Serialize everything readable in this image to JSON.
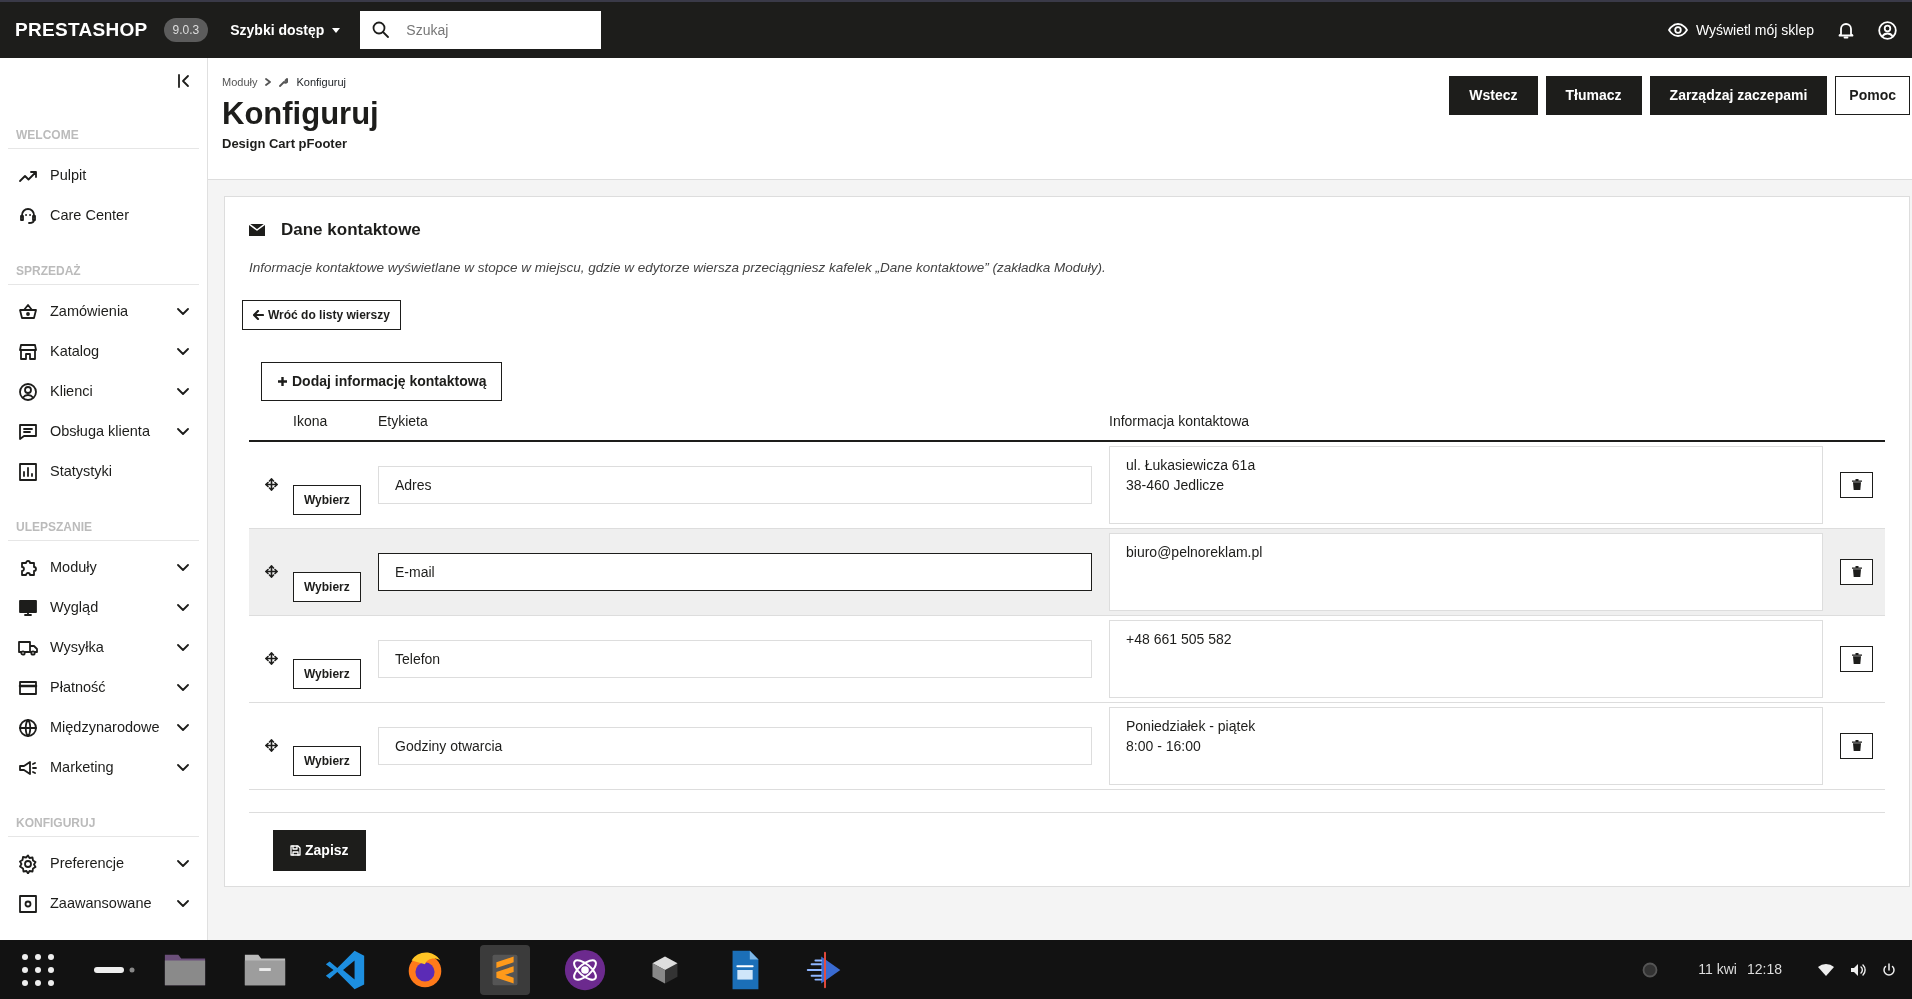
{
  "header": {
    "logo": "PRESTASHOP",
    "version": "9.0.3",
    "quick_access": "Szybki dostęp",
    "search": {
      "placeholder": "Szukaj"
    },
    "view_shop": "Wyświetl mój sklep"
  },
  "sidebar": {
    "sections": [
      {
        "title": "WELCOME",
        "items": [
          {
            "label": "Pulpit",
            "has_submenu": false
          },
          {
            "label": "Care Center",
            "has_submenu": false
          }
        ]
      },
      {
        "title": "SPRZEDAŻ",
        "items": [
          {
            "label": "Zamówienia",
            "has_submenu": true
          },
          {
            "label": "Katalog",
            "has_submenu": true
          },
          {
            "label": "Klienci",
            "has_submenu": true
          },
          {
            "label": "Obsługa klienta",
            "has_submenu": true
          },
          {
            "label": "Statystyki",
            "has_submenu": false
          }
        ]
      },
      {
        "title": "ULEPSZANIE",
        "items": [
          {
            "label": "Moduły",
            "has_submenu": true
          },
          {
            "label": "Wygląd",
            "has_submenu": true
          },
          {
            "label": "Wysyłka",
            "has_submenu": true
          },
          {
            "label": "Płatność",
            "has_submenu": true
          },
          {
            "label": "Międzynarodowe",
            "has_submenu": true
          },
          {
            "label": "Marketing",
            "has_submenu": true
          }
        ]
      },
      {
        "title": "KONFIGURUJ",
        "items": [
          {
            "label": "Preferencje",
            "has_submenu": true
          },
          {
            "label": "Zaawansowane",
            "has_submenu": true
          }
        ]
      }
    ]
  },
  "page": {
    "breadcrumb": [
      "Moduły",
      "Konfiguruj"
    ],
    "title": "Konfiguruj",
    "subtitle": "Design Cart pFooter",
    "toolbar": [
      {
        "label": "Wstecz",
        "kind": "dark"
      },
      {
        "label": "Tłumacz",
        "kind": "dark"
      },
      {
        "label": "Zarządzaj zaczepami",
        "kind": "dark"
      },
      {
        "label": "Pomoc",
        "kind": "outline"
      }
    ]
  },
  "card": {
    "title": "Dane kontaktowe",
    "description": "Informacje kontaktowe wyświetlane w stopce w miejscu, gdzie w edytorze wiersza przeciągniesz kafelek „Dane kontaktowe” (zakładka Moduły).",
    "back_button": "Wróć do listy wierszy",
    "add_button": "Dodaj informację kontaktową",
    "columns": [
      "Ikona",
      "Etykieta",
      "Informacja kontaktowa"
    ],
    "rows": [
      {
        "icon_button": "Wybierz",
        "label": "Adres",
        "info": "ul. Łukasiewicza 61a\n38-460 Jedlicze",
        "hovered": false,
        "focused": false
      },
      {
        "icon_button": "Wybierz",
        "label": "E-mail",
        "info": "biuro@pelnoreklam.pl",
        "hovered": true,
        "focused": true
      },
      {
        "icon_button": "Wybierz",
        "label": "Telefon",
        "info": "+48 661 505 582",
        "hovered": false,
        "focused": false
      },
      {
        "icon_button": "Wybierz",
        "label": "Godziny otwarcia",
        "info": "Poniedziałek - piątek\n8:00 - 16:00",
        "hovered": false,
        "focused": false
      }
    ],
    "save_button": "Zapisz"
  },
  "taskbar": {
    "date": "11 kwi",
    "time": "12:18"
  }
}
